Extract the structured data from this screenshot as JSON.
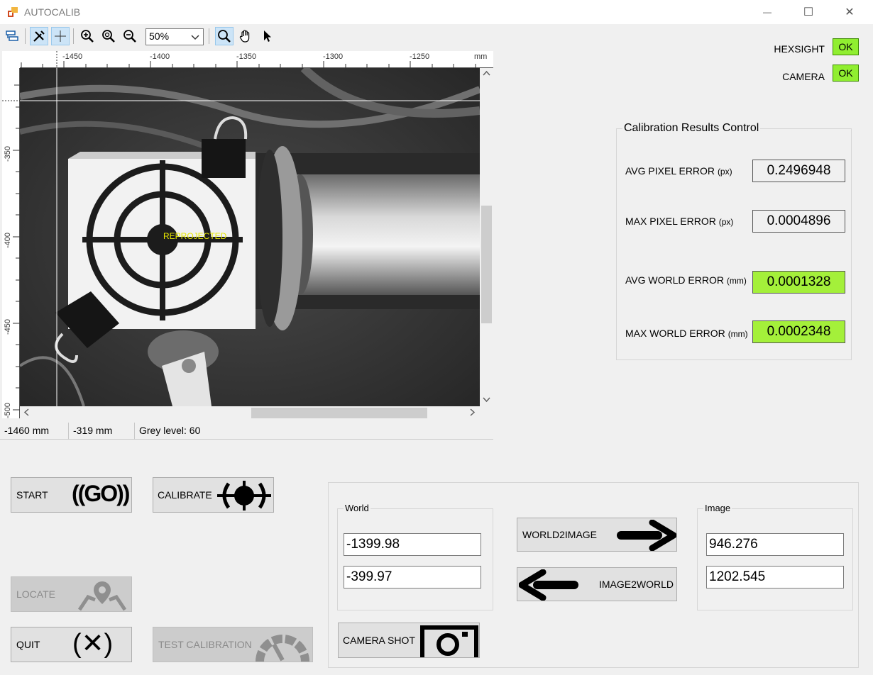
{
  "window": {
    "title": "AUTOCALIB",
    "minimize_glyph": "—",
    "maximize_glyph": "☐",
    "close_glyph": "✕"
  },
  "toolbar": {
    "zoom_value": "50%",
    "icons": [
      "layers-icon",
      "tools-icon",
      "crosshair-icon",
      "zoom-in-icon",
      "zoom-fit-icon",
      "zoom-out-icon",
      "magnifier-icon",
      "hand-icon",
      "pointer-icon"
    ]
  },
  "ruler": {
    "x_labels": [
      "-1450",
      "-1400",
      "-1350",
      "-1300",
      "-1250",
      "mm"
    ],
    "y_labels": [
      "-350",
      "-400",
      "-450",
      "-500"
    ]
  },
  "viewport": {
    "overlay_text": "REPROJECTED"
  },
  "status": {
    "x": "-1460 mm",
    "y": "-319 mm",
    "grey": "Grey level: 60"
  },
  "connections": {
    "hexsight_label": "HEXSIGHT",
    "hexsight_status": "OK",
    "camera_label": "CAMERA",
    "camera_status": "OK"
  },
  "calibration_results": {
    "title": "Calibration Results Control",
    "avg_pixel_label": "AVG PIXEL ERROR",
    "avg_pixel_unit": "(px)",
    "avg_pixel_value": "0.2496948",
    "max_pixel_label": "MAX PIXEL ERROR",
    "max_pixel_unit": "(px)",
    "max_pixel_value": "0.0004896",
    "avg_world_label": "AVG WORLD ERROR",
    "avg_world_unit": "(mm)",
    "avg_world_value": "0.0001328",
    "max_world_label": "MAX WORLD ERROR",
    "max_world_unit": "(mm)",
    "max_world_value": "0.0002348",
    "good_color": "#a4f03a"
  },
  "buttons": {
    "start": "START",
    "start_icon_text": "((GO))",
    "calibrate": "CALIBRATE",
    "locate": "LOCATE",
    "quit": "QUIT",
    "quit_icon_text": "(✕)",
    "test_calibration": "TEST CALIBRATION",
    "world2image": "WORLD2IMAGE",
    "image2world": "IMAGE2WORLD",
    "camera_shot": "CAMERA SHOT"
  },
  "conversion": {
    "world_title": "World",
    "world_x": "-1399.98",
    "world_y": "-399.97",
    "image_title": "Image",
    "image_x": "946.276",
    "image_y": "1202.545"
  }
}
